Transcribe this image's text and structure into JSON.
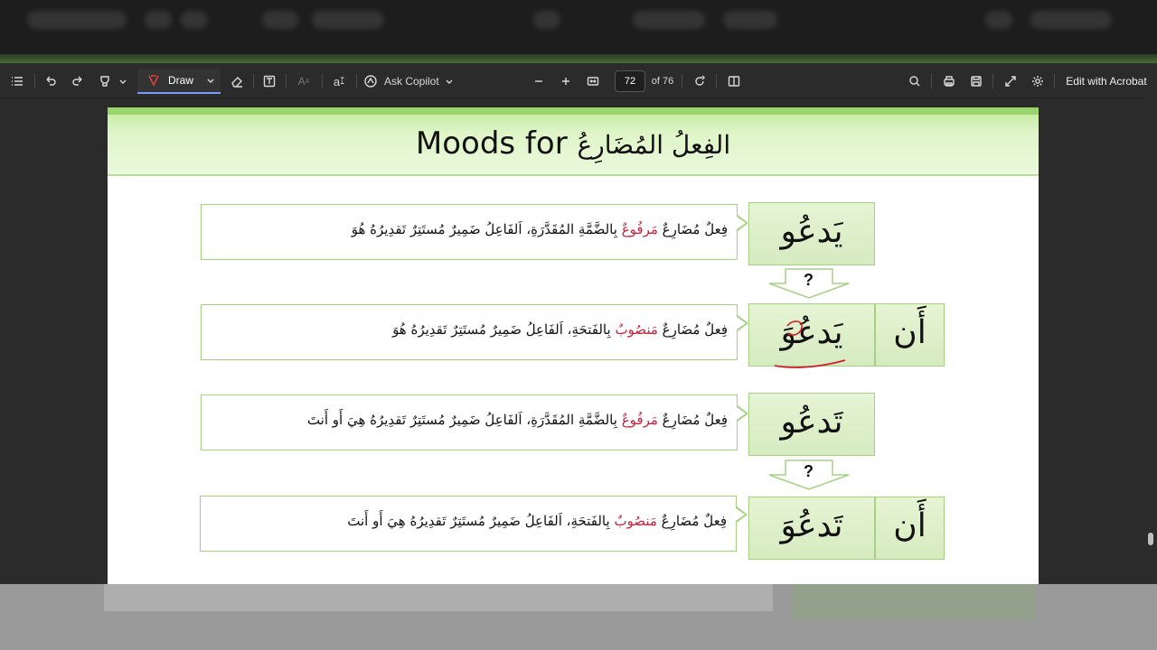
{
  "toolbar": {
    "draw_label": "Draw",
    "ask_copilot_label": "Ask Copilot",
    "page_number": "72",
    "page_total": "of 76",
    "edit_label": "Edit with Acrobat"
  },
  "page": {
    "title_en": "Moods for",
    "title_ar": "الفِعلُ المُضَارِعُ",
    "rows": [
      {
        "word": "يَدعُو",
        "particle": "",
        "desc_before": "فِعلٌ مُضَارِعٌ ",
        "desc_case": "مَرفُوعٌ",
        "desc_after": " بِالضَّمَّةِ المُقَدَّرَةِ، اَلفَاعِلُ ضَمِيرٌ مُستَتِرٌ تَقدِيرُهُ هُوَ"
      },
      {
        "word": "يَدعُوَ",
        "particle": "أَن",
        "desc_before": "فِعلٌ مُضَارِعٌ ",
        "desc_case": "مَنصُوبٌ",
        "desc_after": " بِالفَتحَةِ، اَلفَاعِلُ ضَمِيرٌ مُستَتِرٌ تَقدِيرُهُ هُوَ"
      },
      {
        "word": "تَدعُو",
        "particle": "",
        "desc_before": "فِعلٌ مُضَارِعٌ ",
        "desc_case": "مَرفُوعٌ",
        "desc_after": " بِالضَّمَّةِ المُقَدَّرَةِ، اَلفَاعِلُ ضَمِيرٌ مُستَتِرٌ تَقدِيرُهُ هِيَ أَو أَنتَ"
      },
      {
        "word": "تَدعُوَ",
        "particle": "أَن",
        "desc_before": "فِعلٌ مُضَارِعٌ ",
        "desc_case": "مَنصُوبٌ",
        "desc_after": " بِالفَتحَةِ، اَلفَاعِلُ ضَمِيرٌ مُستَتِرٌ تَقدِيرُهُ هِيَ أَو أَنتَ"
      }
    ],
    "question_mark": "?"
  },
  "colors": {
    "header_green": "#9ad46a",
    "box_border": "#a7cf86",
    "case_red": "#c0233c",
    "ink_annotation": "#d0202a"
  },
  "icons": [
    "list-icon",
    "undo-icon",
    "redo-icon",
    "highlighter-icon",
    "pen-icon",
    "eraser-icon",
    "text-box-icon",
    "text-size-icon",
    "read-aloud-icon",
    "copilot-icon",
    "zoom-out-icon",
    "zoom-in-icon",
    "fit-page-icon",
    "rotate-icon",
    "page-view-icon",
    "search-icon",
    "print-icon",
    "save-icon",
    "fullscreen-icon",
    "settings-icon"
  ]
}
